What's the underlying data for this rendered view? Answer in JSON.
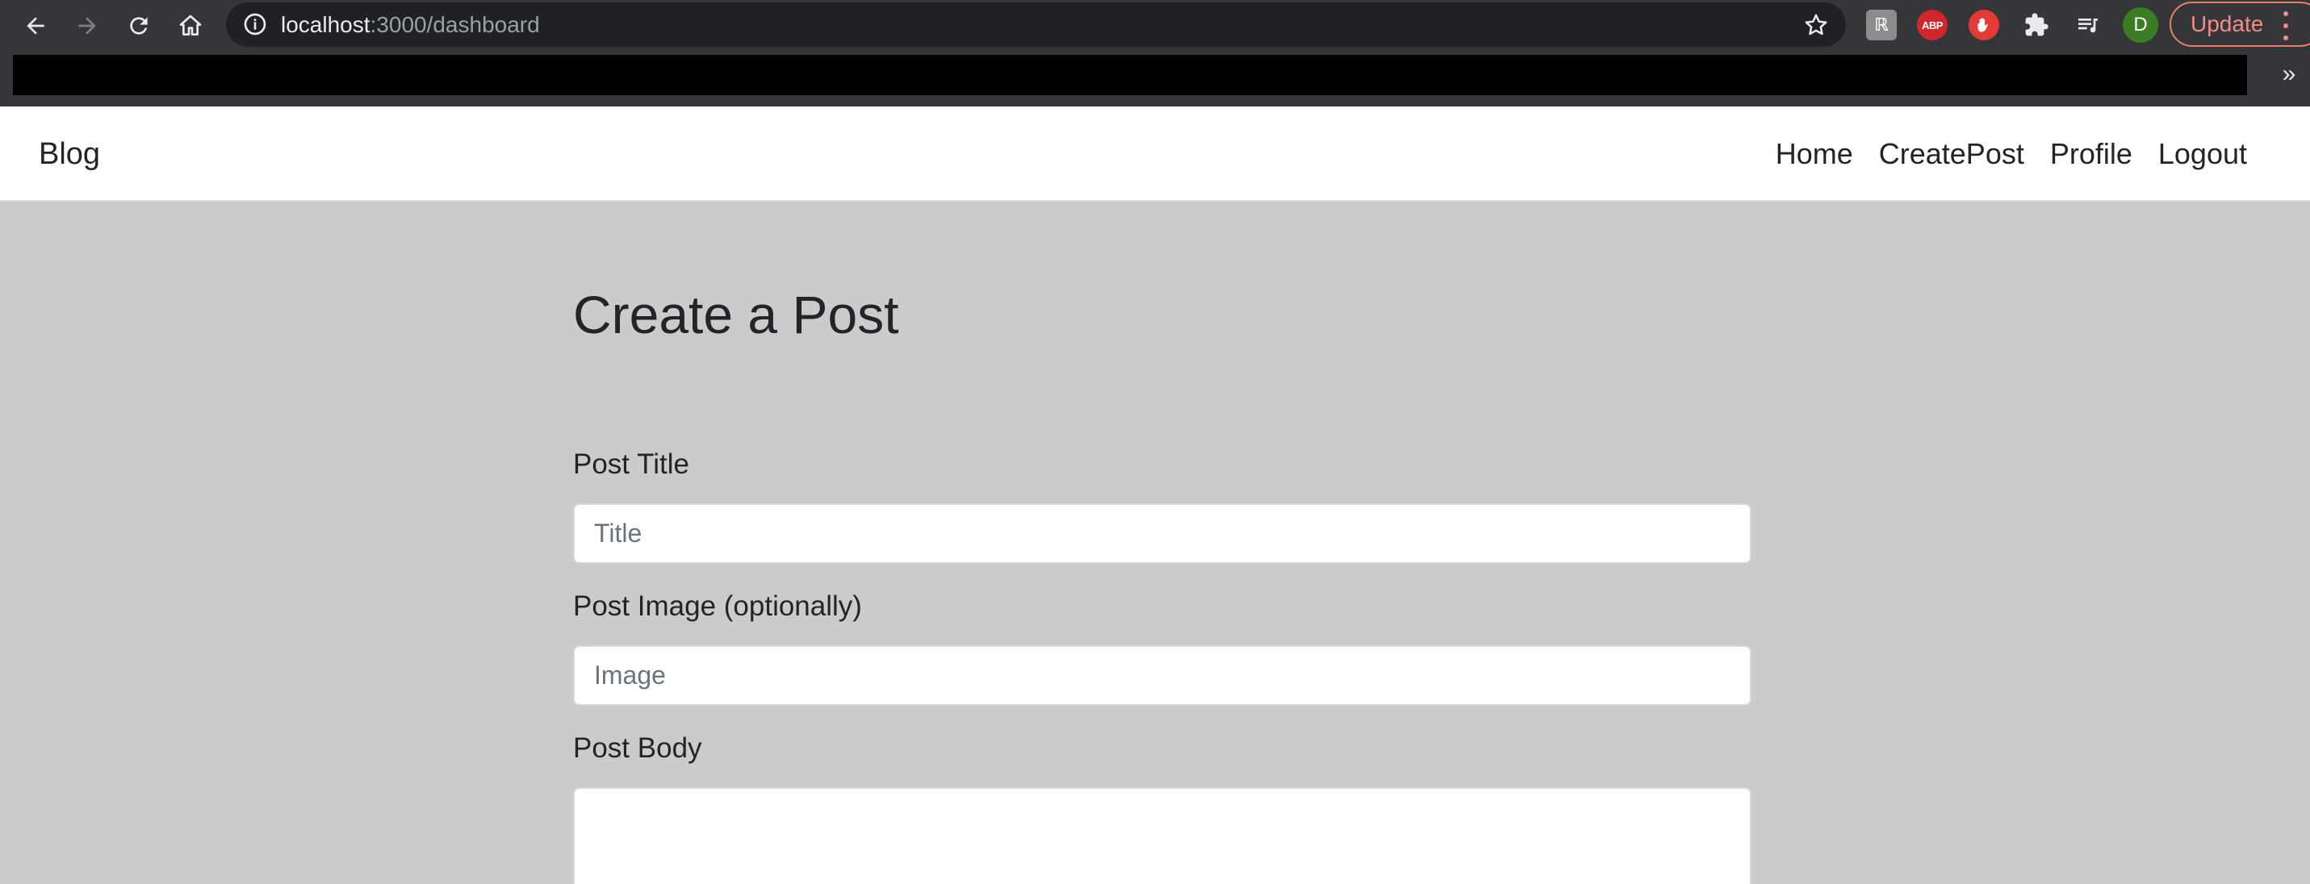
{
  "browser": {
    "url_host": "localhost",
    "url_path": ":3000/dashboard",
    "profile_initial": "D",
    "update_label": "Update",
    "bookmarks_more": "»",
    "extensions": [
      "gray-extension-icon",
      "adblock-plus-icon",
      "stop-hand-icon",
      "puzzle-extensions-icon",
      "media-queue-icon"
    ],
    "abp_text": "ABP",
    "gray_ext_text": "ℝ"
  },
  "navbar": {
    "brand": "Blog",
    "links": [
      "Home",
      "CreatePost",
      "Profile",
      "Logout"
    ]
  },
  "form": {
    "heading": "Create a Post",
    "title_label": "Post Title",
    "title_placeholder": "Title",
    "image_label": "Post Image (optionally)",
    "image_placeholder": "Image",
    "body_label": "Post Body"
  },
  "colors": {
    "page_background": "#cbcbcb",
    "chrome_background": "#35363a",
    "update_accent": "#f28b82",
    "avatar": "#3a7d23"
  }
}
